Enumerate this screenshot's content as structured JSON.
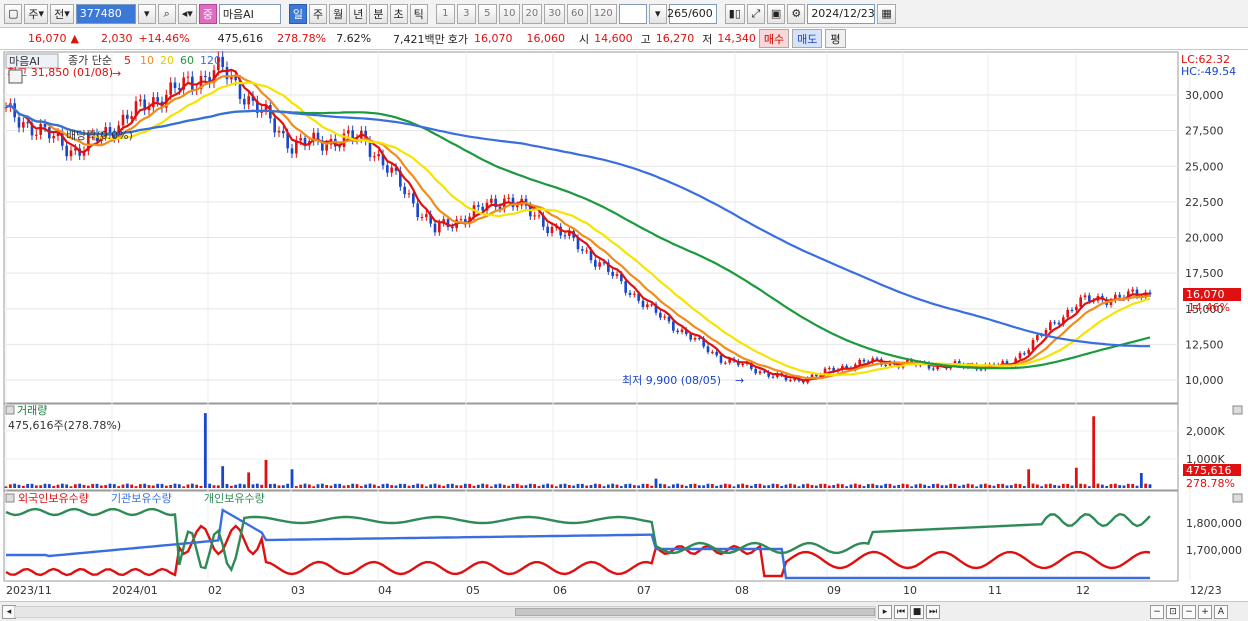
{
  "toolbar": {
    "period_type": "주",
    "prev_label": "전",
    "code": "377480",
    "marker": "중",
    "name": "마음AI",
    "periods": [
      "일",
      "주",
      "월",
      "년",
      "분",
      "초",
      "틱"
    ],
    "active_period": "일",
    "numbers": [
      "1",
      "3",
      "5",
      "10",
      "20",
      "30",
      "60",
      "120"
    ],
    "count": "265",
    "count_total": "/600",
    "date": "2024/12/23"
  },
  "quote": {
    "price": "16,070",
    "arrow": "▲",
    "change": "2,030",
    "change_pct": "+14.46%",
    "volume": "475,616",
    "volume_ratio": "278.78%",
    "turnover": "7.62%",
    "amount": "7,421백만",
    "hoga_label": "호가",
    "hoga_ask": "16,070",
    "hoga_bid": "16,060",
    "open_label": "시",
    "open": "14,600",
    "high_label": "고",
    "high": "16,270",
    "low_label": "저",
    "low": "14,340",
    "buy_btn": "매수",
    "sell_btn": "매도",
    "flat_btn": "평"
  },
  "price_panel": {
    "name_tag": "마음AI",
    "ma_label": "종가 단순",
    "ma_periods": [
      "5",
      "10",
      "20",
      "60",
      "120"
    ],
    "ma_colors": [
      "#e01010",
      "#f08c1a",
      "#f5e400",
      "#1a9a3c",
      "#3a6ee0"
    ],
    "high_note": "최고 31,850 (01/08)",
    "low_note": "최저 9,900 (08/05)",
    "dividend_note": "배당락(0.0%)",
    "lc": "LC:62.32",
    "hc": "HC:-49.54",
    "last_price": "16,070",
    "last_pct": "14.46%",
    "y_ticks": [
      "30,000",
      "27,500",
      "25,000",
      "22,500",
      "20,000",
      "17,500",
      "15,000",
      "12,500",
      "10,000"
    ]
  },
  "volume_panel": {
    "title": "거래량",
    "info": "475,616주(278.78%)",
    "y_ticks": [
      "2,000K",
      "1,000K"
    ],
    "last_volume": "475,616",
    "last_ratio": "278.78%"
  },
  "holders_panel": {
    "legend": [
      "외국인보유수량",
      "기관보유수량",
      "개인보유수량"
    ],
    "colors": [
      "#e01010",
      "#3a6ee0",
      "#2e8b57"
    ],
    "y_ticks": [
      "1,800,000",
      "1,700,000"
    ]
  },
  "x_axis": {
    "labels": [
      "2023/11",
      "2024/01",
      "02",
      "03",
      "04",
      "05",
      "06",
      "07",
      "08",
      "09",
      "10",
      "11",
      "12",
      "12/23"
    ]
  },
  "chart_data": {
    "type": "line",
    "price_close": [
      {
        "x": "2023/11",
        "y": 28800
      },
      {
        "x": "2023/12",
        "y": 26000
      },
      {
        "x": "2024/01",
        "y": 29500
      },
      {
        "x": "2024/01/08",
        "y": 31850
      },
      {
        "x": "2024/02",
        "y": 26500
      },
      {
        "x": "2024/03",
        "y": 27000
      },
      {
        "x": "2024/04",
        "y": 20500
      },
      {
        "x": "2024/05",
        "y": 22800
      },
      {
        "x": "2024/06",
        "y": 19500
      },
      {
        "x": "2024/07",
        "y": 15000
      },
      {
        "x": "2024/08",
        "y": 11500
      },
      {
        "x": "2024/08/05",
        "y": 9900
      },
      {
        "x": "2024/09",
        "y": 11300
      },
      {
        "x": "2024/10",
        "y": 11000
      },
      {
        "x": "2024/11",
        "y": 11000
      },
      {
        "x": "2024/12",
        "y": 15500
      },
      {
        "x": "2024/12/23",
        "y": 16070
      }
    ],
    "volume_peaks": [
      {
        "x": "2024/01",
        "y": 2400000
      },
      {
        "x": "2024/07",
        "y": 300000
      },
      {
        "x": "2024/11",
        "y": 600000
      },
      {
        "x": "2024/12",
        "y": 2300000
      },
      {
        "x": "2024/12/23",
        "y": 475616
      }
    ]
  }
}
